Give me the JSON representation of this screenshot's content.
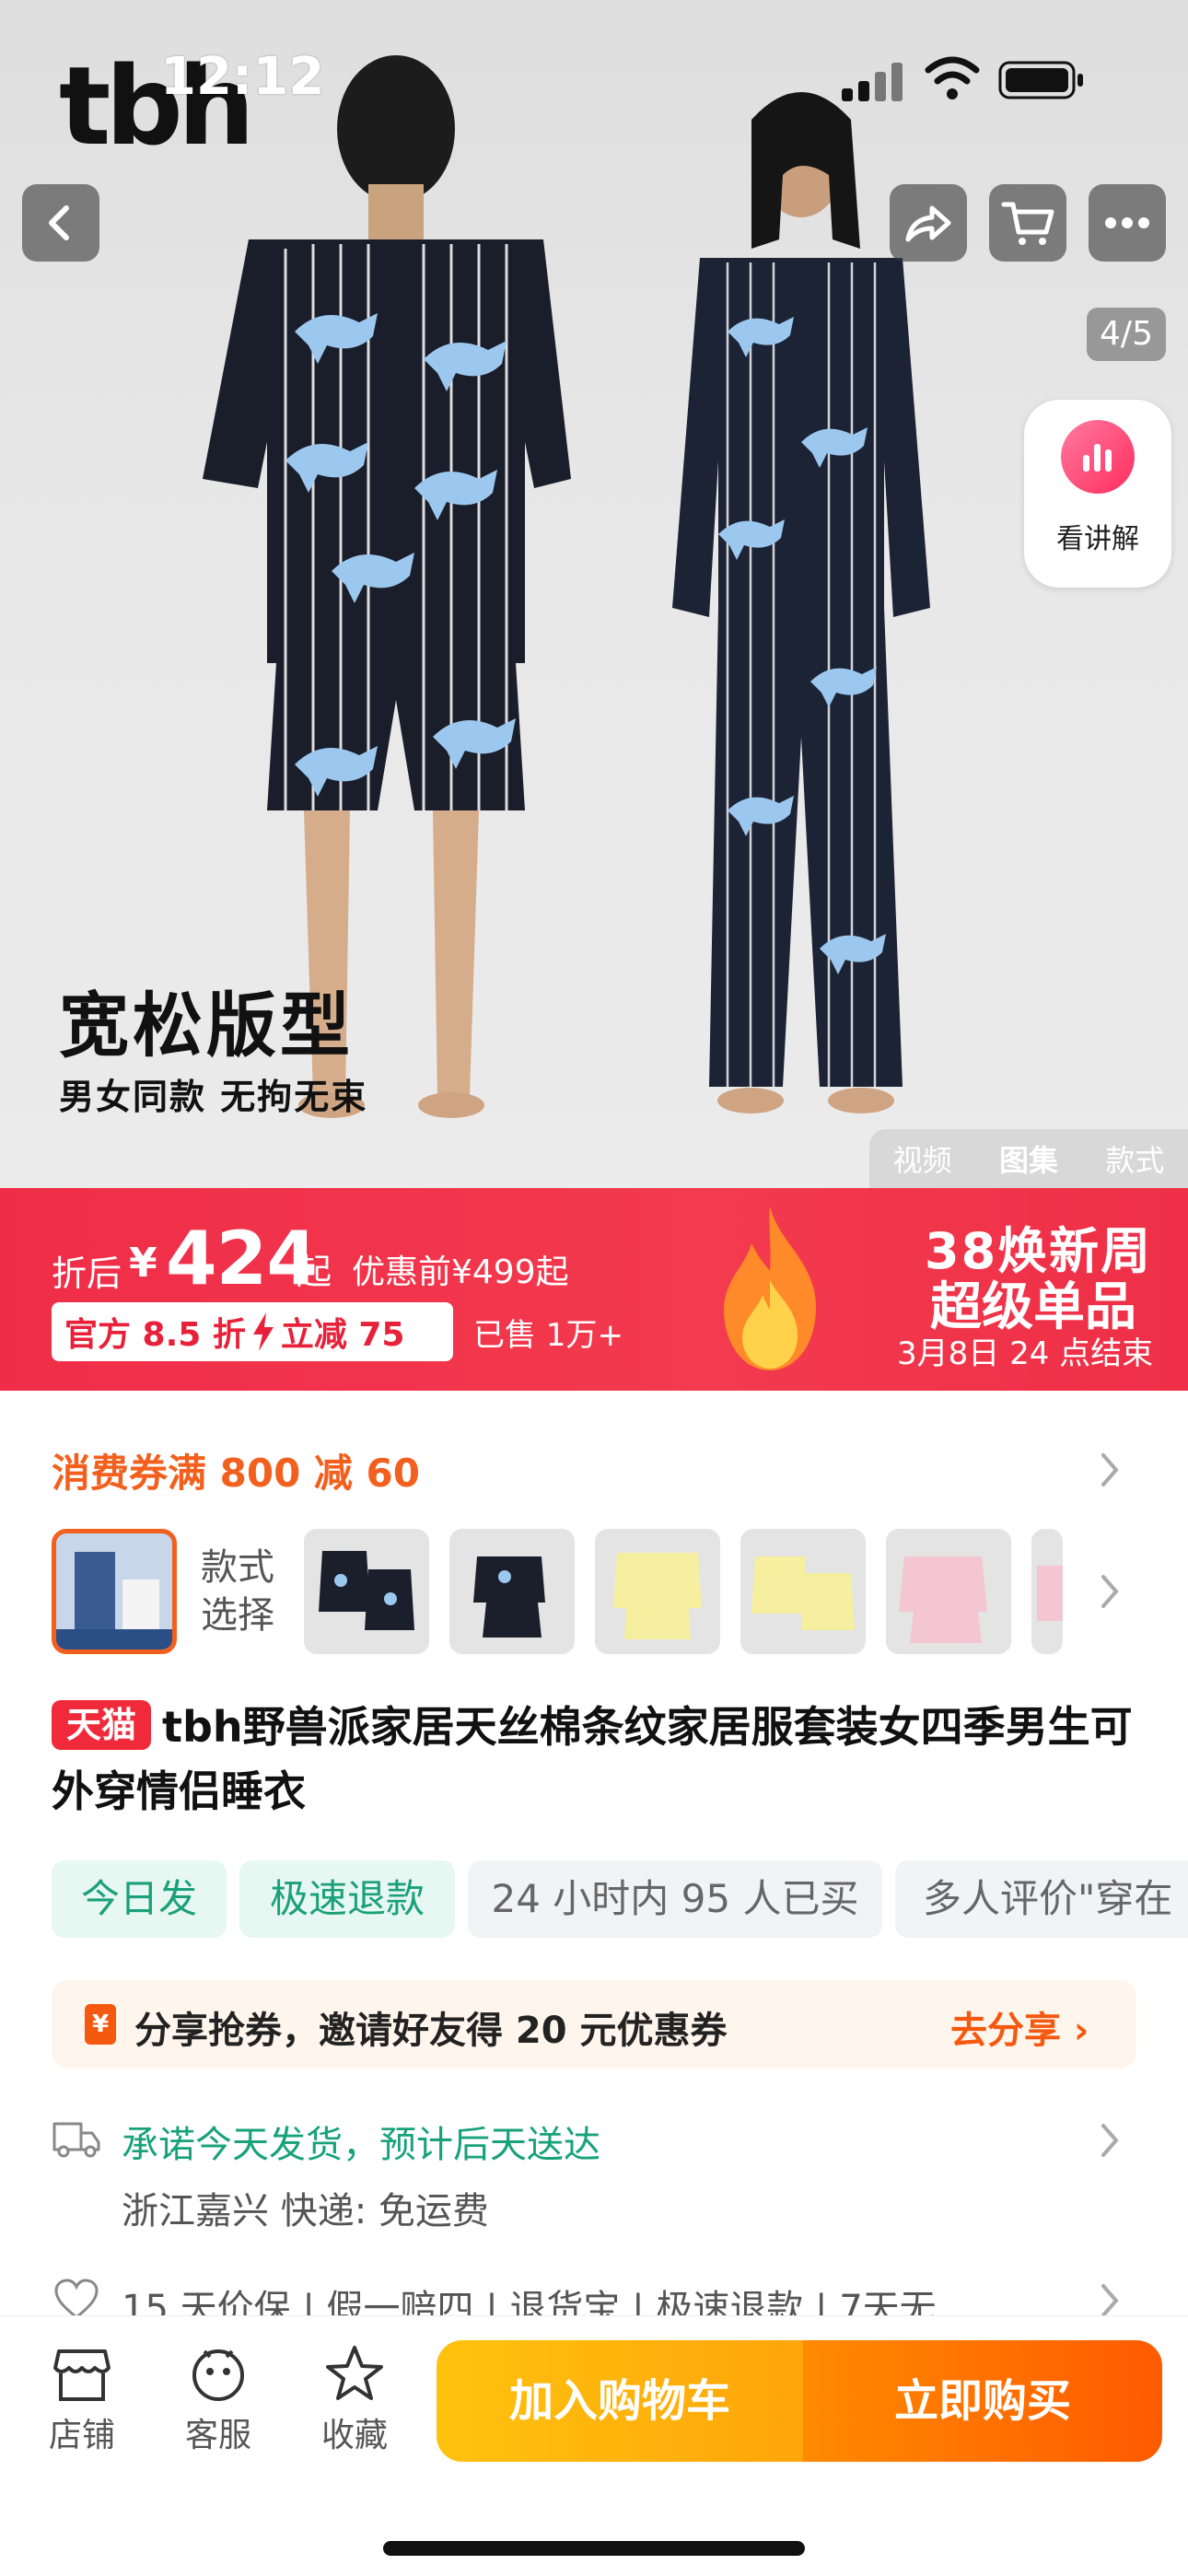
{
  "status_bar": {
    "time": "12:12"
  },
  "hero": {
    "brand": "tbh",
    "counter": "4/5",
    "explain_label": "看讲解",
    "title": "宽松版型",
    "subtitle": "男女同款  无拘无束",
    "media_tabs": [
      "视频",
      "图集",
      "款式"
    ],
    "active_tab_index": 1
  },
  "promo": {
    "after_label": "折后",
    "currency": "¥",
    "price": "424",
    "from_label": "起",
    "before_label": "优惠前¥499起",
    "badge_left": "官方 8.5 折",
    "badge_right": "立减 75",
    "sold": "已售 1万+",
    "event_line1": "38焕新周",
    "event_line2": "超级单品",
    "event_end": "3月8日 24 点结束",
    "colors": {
      "banner": "#ef2d48",
      "badge_text": "#e8213a"
    }
  },
  "coupon": {
    "text": "消费券满 800 减 60"
  },
  "styles": {
    "label_line1": "款式",
    "label_line2": "选择"
  },
  "product": {
    "tag": "天猫",
    "title": "tbh野兽派家居天丝棉条纹家居服套装女四季男生可外穿情侣睡衣"
  },
  "chips": [
    "今日发",
    "极速退款",
    "24 小时内 95 人已买",
    "多人评价\"穿在"
  ],
  "share": {
    "icon_char": "¥",
    "text": "分享抢券，邀请好友得 20 元优惠券",
    "cta": "去分享 ›"
  },
  "delivery": {
    "promise": "承诺今天发货，预计后天送达",
    "detail": "浙江嘉兴  快递: 免运费"
  },
  "services": "15 天价保 | 假一赔四 | 退货宝 | 极速退款 | 7天无...",
  "bottom_bar": {
    "shop": "店铺",
    "service": "客服",
    "favorite": "收藏",
    "add_to_cart": "加入购物车",
    "buy_now": "立即购买"
  }
}
